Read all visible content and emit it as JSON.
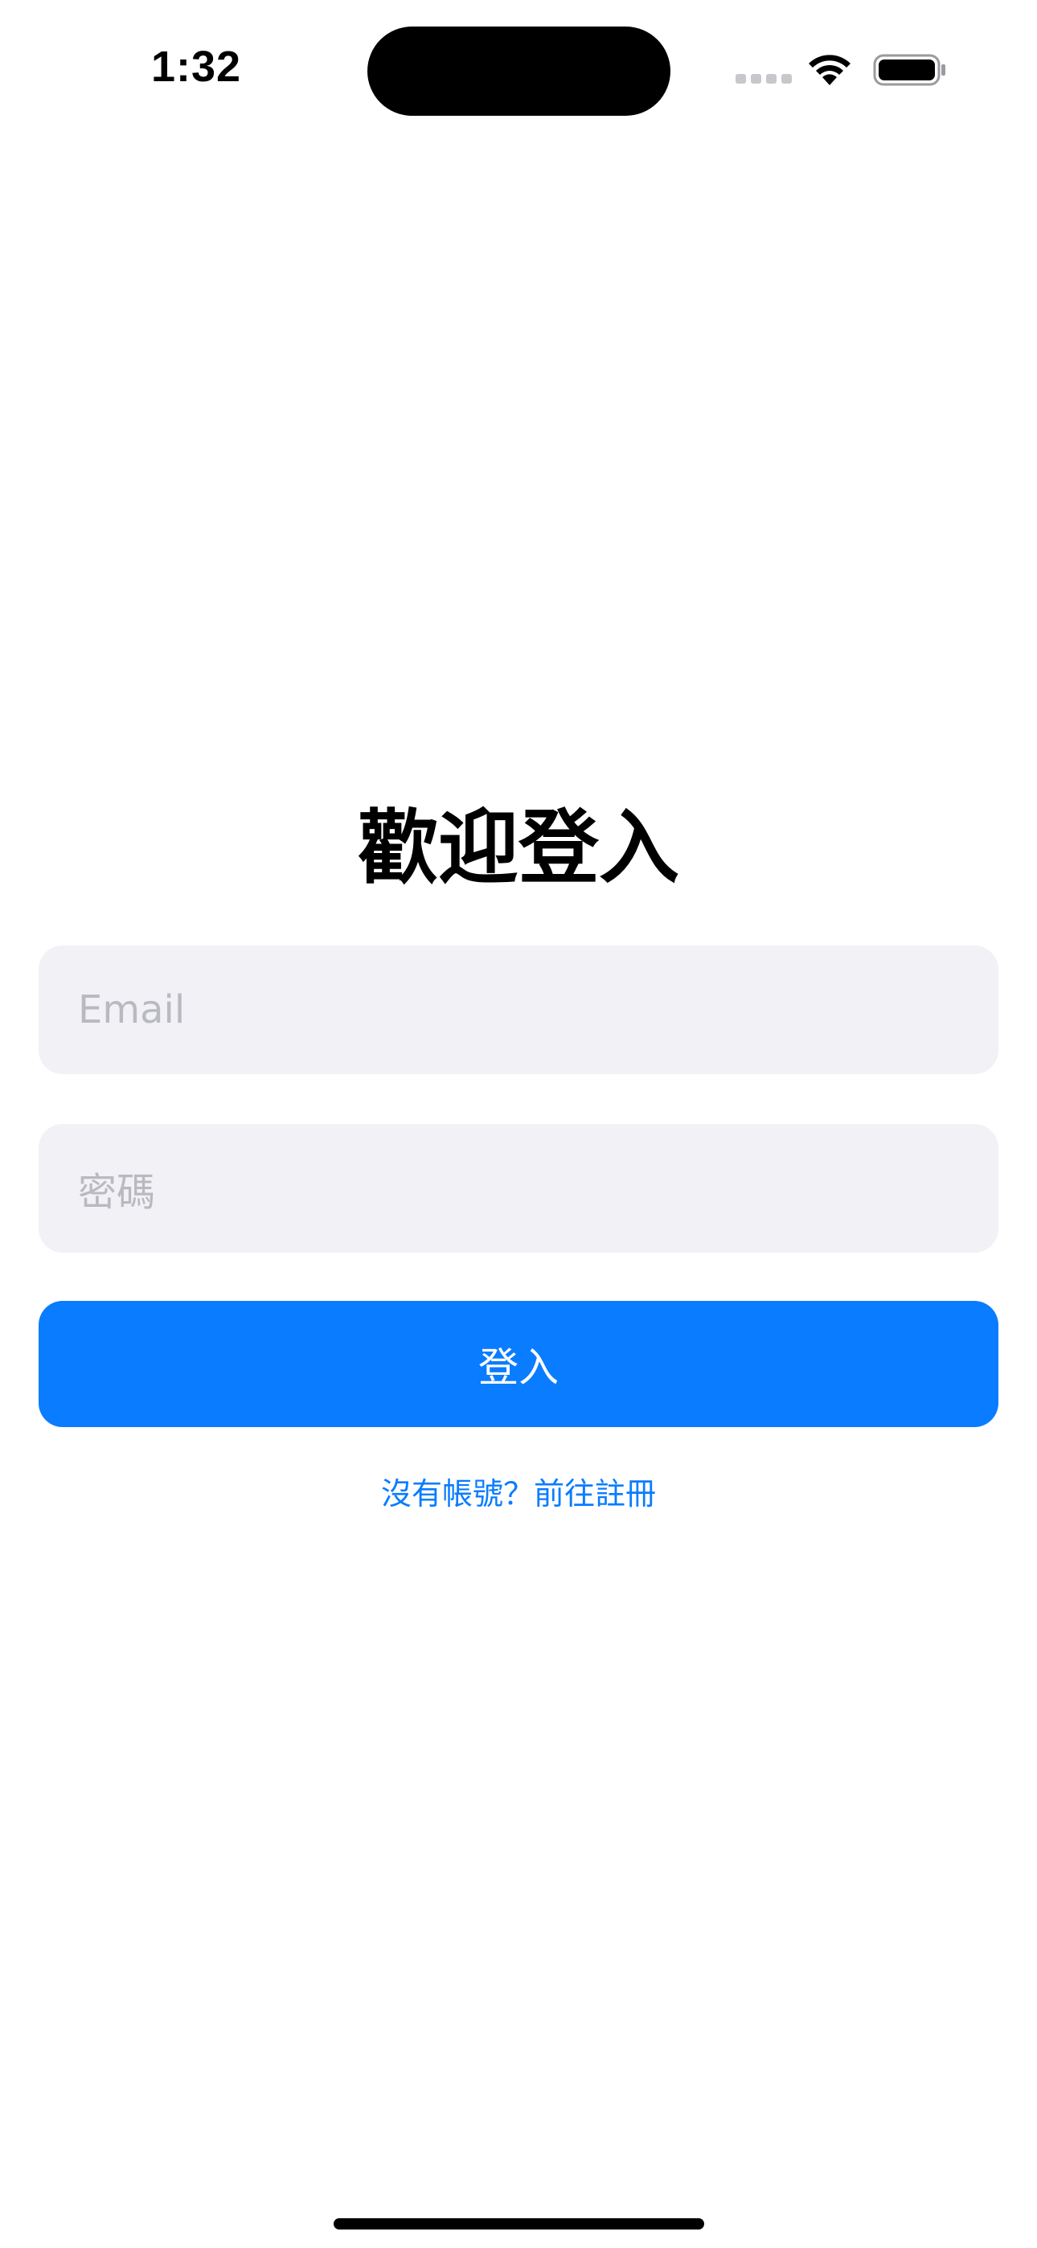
{
  "status_bar": {
    "time": "1:32",
    "icons": [
      "cellular-signal-icon",
      "wifi-icon",
      "battery-icon"
    ]
  },
  "login": {
    "title": "歡迎登入",
    "email_placeholder": "Email",
    "password_placeholder": "密碼",
    "login_button_label": "登入",
    "register_link_label": "沒有帳號？前往註冊"
  },
  "colors": {
    "accent": "#0a7cff",
    "field_background": "#f1f1f6",
    "placeholder_text": "#b9b9c0",
    "background": "#ffffff"
  }
}
